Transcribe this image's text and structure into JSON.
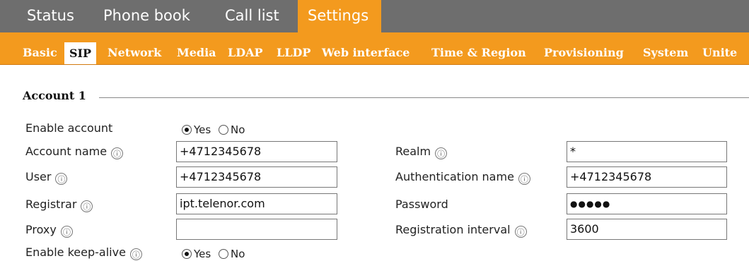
{
  "main_tabs": [
    {
      "label": "Status",
      "active": false
    },
    {
      "label": "Phone book",
      "active": false
    },
    {
      "label": "Call list",
      "active": false
    },
    {
      "label": "Settings",
      "active": true
    }
  ],
  "sub_tabs": [
    {
      "label": "Basic",
      "active": false
    },
    {
      "label": "SIP",
      "active": true
    },
    {
      "label": "Network",
      "active": false
    },
    {
      "label": "Media",
      "active": false
    },
    {
      "label": "LDAP",
      "active": false
    },
    {
      "label": "LLDP",
      "active": false
    },
    {
      "label": "Web interface",
      "active": false
    },
    {
      "label": "Time & Region",
      "active": false
    },
    {
      "label": "Provisioning",
      "active": false
    },
    {
      "label": "System",
      "active": false
    },
    {
      "label": "Unite",
      "active": false
    }
  ],
  "section": {
    "title": "Account 1"
  },
  "form": {
    "enable_account": {
      "label": "Enable account",
      "yes": "Yes",
      "no": "No",
      "value": "Yes"
    },
    "account_name": {
      "label": "Account name",
      "value": "+4712345678"
    },
    "user": {
      "label": "User",
      "value": "+4712345678"
    },
    "registrar": {
      "label": "Registrar",
      "value": "ipt.telenor.com"
    },
    "proxy": {
      "label": "Proxy",
      "value": ""
    },
    "enable_keepalive": {
      "label": "Enable keep-alive",
      "yes": "Yes",
      "no": "No",
      "value": "Yes"
    },
    "realm": {
      "label": "Realm",
      "value": "*"
    },
    "auth_name": {
      "label": "Authentication name",
      "value": "+4712345678"
    },
    "password": {
      "label": "Password",
      "value": "●●●●●"
    },
    "reg_interval": {
      "label": "Registration interval",
      "value": "3600"
    }
  },
  "icons": {
    "info": "ⓘ"
  },
  "colors": {
    "accent": "#f39a1e",
    "topbar": "#6e6e6e"
  }
}
